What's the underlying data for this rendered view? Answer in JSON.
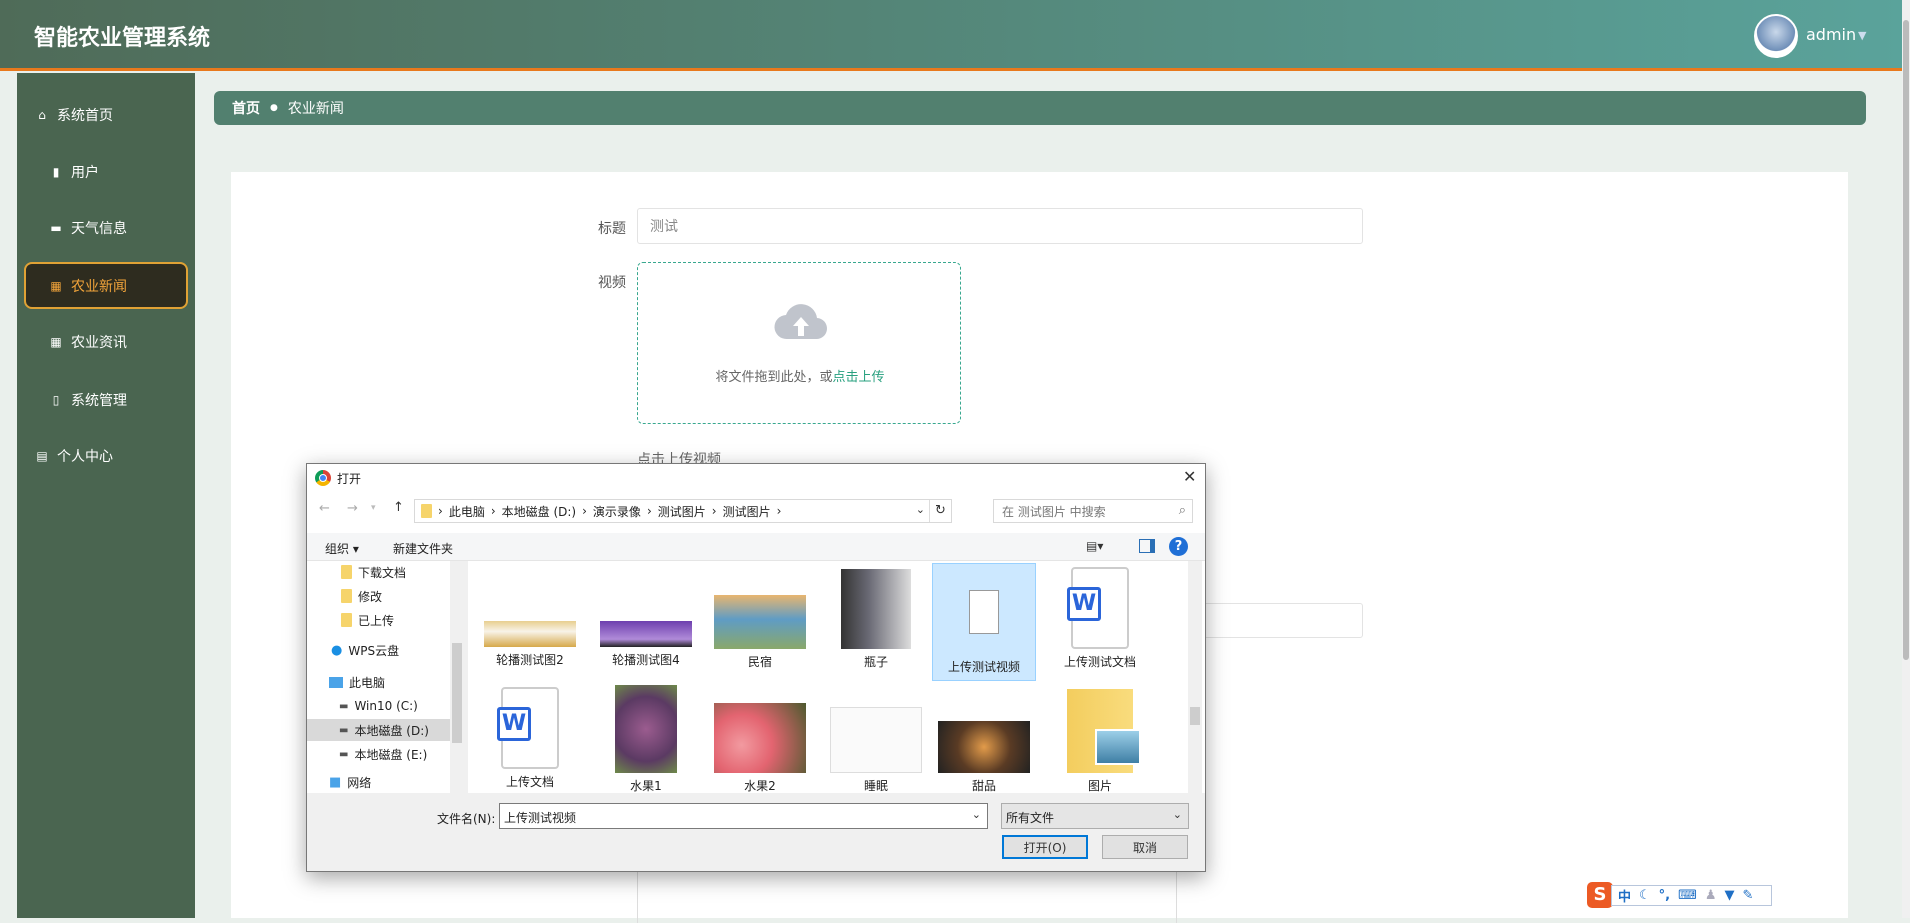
{
  "header": {
    "title": "智能农业管理系统",
    "user": "admin"
  },
  "sidebar": {
    "items": [
      {
        "label": "系统首页",
        "icon": "home-icon"
      },
      {
        "label": "用户",
        "icon": "bar-chart-icon"
      },
      {
        "label": "天气信息",
        "icon": "ticket-icon"
      },
      {
        "label": "农业新闻",
        "icon": "grid-icon",
        "active": true
      },
      {
        "label": "农业资讯",
        "icon": "grid-icon"
      },
      {
        "label": "系统管理",
        "icon": "clipboard-icon"
      },
      {
        "label": "个人中心",
        "icon": "calendar-icon"
      }
    ]
  },
  "breadcrumb": {
    "home": "首页",
    "current": "农业新闻"
  },
  "form": {
    "title_label": "标题",
    "title_value": "测试",
    "video_label": "视频",
    "upload_text": "将文件拖到此处，或",
    "upload_link": "点击上传",
    "upload_hint": "点击上传视频"
  },
  "dialog": {
    "title": "打开",
    "path": [
      "此电脑",
      "本地磁盘 (D:)",
      "演示录像",
      "测试图片",
      "测试图片"
    ],
    "search_placeholder": "在 测试图片 中搜索",
    "organize": "组织 ▾",
    "new_folder": "新建文件夹",
    "nav": [
      "下载文档",
      "修改",
      "已上传",
      "WPS云盘",
      "此电脑",
      "Win10 (C:)",
      "本地磁盘 (D:)",
      "本地磁盘 (E:)",
      "网络"
    ],
    "files": [
      "轮播测试图2",
      "轮播测试图4",
      "民宿",
      "瓶子",
      "上传测试视频",
      "上传测试文档",
      "上传文档",
      "水果1",
      "水果2",
      "睡眠",
      "甜品",
      "图片"
    ],
    "filename_label": "文件名(N):",
    "filename_value": "上传测试视频",
    "filetype": "所有文件",
    "open": "打开(O)",
    "cancel": "取消"
  },
  "ime": {
    "lang": "中"
  }
}
